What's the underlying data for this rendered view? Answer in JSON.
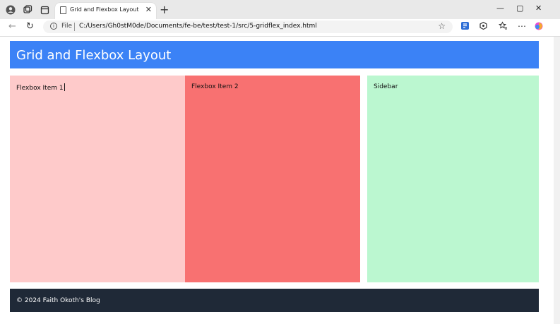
{
  "browser": {
    "tab_title": "Grid and Flexbox Layout",
    "address_scheme_label": "File",
    "url": "C:/Users/Gh0stM0de/Documents/fe-be/test/test-1/src/5-gridflex_index.html",
    "icons": [
      "profile-icon",
      "workspaces-icon",
      "tab-actions-icon",
      "page-icon",
      "close-icon",
      "new-tab-icon",
      "minimize-icon",
      "maximize-icon",
      "window-close-icon",
      "back-icon",
      "refresh-icon",
      "info-icon",
      "favorite-star-icon",
      "extension-icon",
      "browser-essentials-icon",
      "favorites-icon",
      "more-icon",
      "copilot-icon"
    ]
  },
  "page": {
    "header_title": "Grid and Flexbox Layout",
    "flex_item_1": "Flexbox Item 1",
    "flex_item_2": "Flexbox Item 2",
    "sidebar": "Sidebar",
    "footer": "© 2024 Faith Okoth's Blog"
  },
  "colors": {
    "header": "#3b82f6",
    "flex_item_1": "#fecaca",
    "flex_item_2": "#f87171",
    "sidebar": "#bbf7d0",
    "footer": "#1f2937"
  }
}
